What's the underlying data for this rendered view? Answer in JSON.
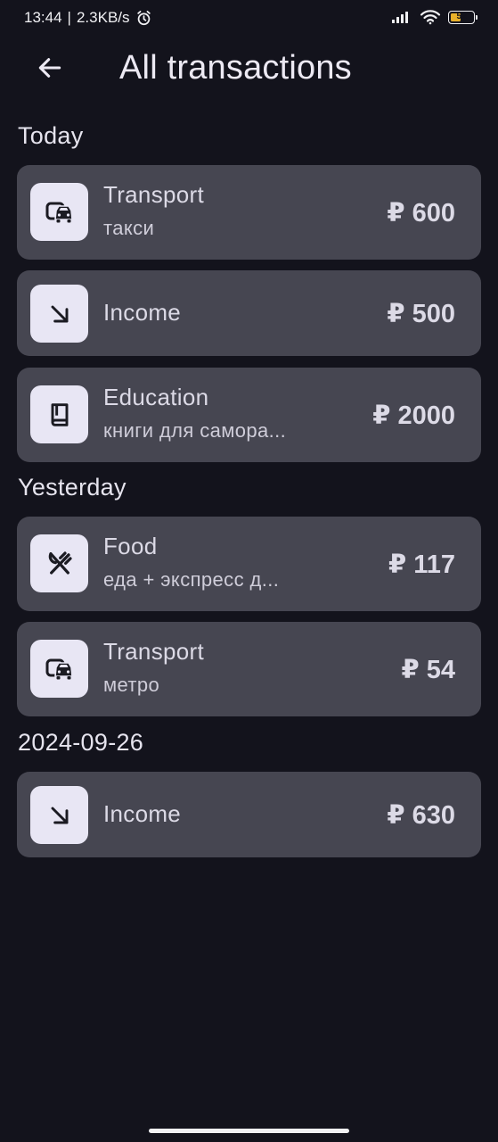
{
  "status_bar": {
    "time": "13:44",
    "separator": "|",
    "network_speed": "2.3KB/s",
    "battery_level": "52",
    "icons": [
      "alarm-icon",
      "signal-icon",
      "wifi-icon",
      "battery-icon"
    ]
  },
  "header": {
    "title": "All transactions",
    "back_icon": "arrow-left-icon"
  },
  "sections": [
    {
      "label": "Today",
      "transactions": [
        {
          "category": "Transport",
          "note": "такси",
          "amount": "₽ 600",
          "icon": "transport-icon"
        },
        {
          "category": "Income",
          "note": "",
          "amount": "₽ 500",
          "icon": "arrow-down-right-icon"
        },
        {
          "category": "Education",
          "note": "книги для самора...",
          "amount": "₽ 2000",
          "icon": "book-icon"
        }
      ]
    },
    {
      "label": "Yesterday",
      "transactions": [
        {
          "category": "Food",
          "note": "еда + экспресс д...",
          "amount": "₽ 117",
          "icon": "utensils-icon"
        },
        {
          "category": "Transport",
          "note": "метро",
          "amount": "₽ 54",
          "icon": "transport-icon"
        }
      ]
    },
    {
      "label": "2024-09-26",
      "transactions": [
        {
          "category": "Income",
          "note": "",
          "amount": "₽ 630",
          "icon": "arrow-down-right-icon"
        }
      ]
    }
  ],
  "colors": {
    "background": "#13131c",
    "card": "#464651",
    "icon_box": "#e8e6f4",
    "text": "#dcdae6",
    "battery_fill": "#e8b02a"
  }
}
